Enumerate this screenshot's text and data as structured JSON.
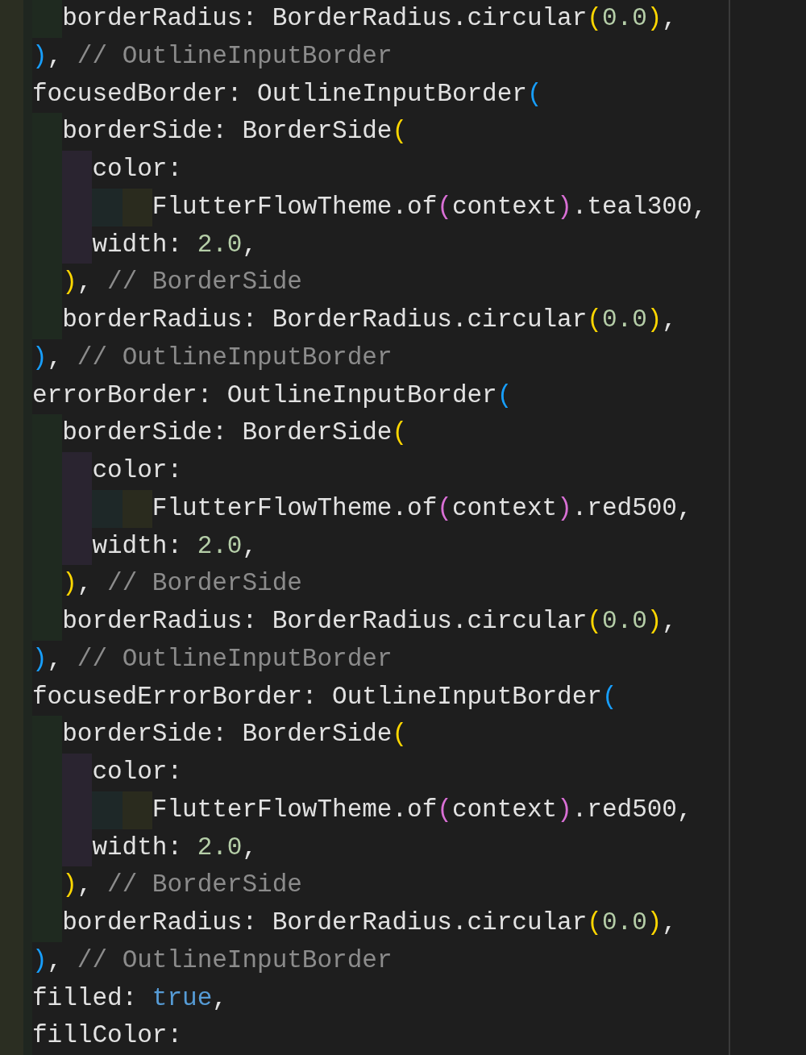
{
  "editor": {
    "lines": [
      {
        "tokens": [
          {
            "text": "  borderRadius: BorderRadius.circular",
            "color": "#e2e2e2"
          },
          {
            "text": "(",
            "color": "#ffd700"
          },
          {
            "text": "0.0",
            "color": "#b5cea8"
          },
          {
            "text": ")",
            "color": "#ffd700"
          },
          {
            "text": ",",
            "color": "#e2e2e2"
          }
        ]
      },
      {
        "tokens": [
          {
            "text": ")",
            "color": "#179fff"
          },
          {
            "text": ", ",
            "color": "#e2e2e2"
          },
          {
            "text": "// OutlineInputBorder",
            "color": "#8c8c8c"
          }
        ]
      },
      {
        "tokens": [
          {
            "text": "focusedBorder: OutlineInputBorder",
            "color": "#e2e2e2"
          },
          {
            "text": "(",
            "color": "#179fff"
          }
        ]
      },
      {
        "tokens": [
          {
            "text": "  borderSide: BorderSide",
            "color": "#e2e2e2"
          },
          {
            "text": "(",
            "color": "#ffd700"
          }
        ]
      },
      {
        "tokens": [
          {
            "text": "    color:",
            "color": "#e2e2e2"
          }
        ]
      },
      {
        "tokens": [
          {
            "text": "        FlutterFlowTheme.of",
            "color": "#e2e2e2"
          },
          {
            "text": "(",
            "color": "#da70d6"
          },
          {
            "text": "context",
            "color": "#e2e2e2"
          },
          {
            "text": ")",
            "color": "#da70d6"
          },
          {
            "text": ".teal300,",
            "color": "#e2e2e2"
          }
        ]
      },
      {
        "tokens": [
          {
            "text": "    width: ",
            "color": "#e2e2e2"
          },
          {
            "text": "2.0",
            "color": "#b5cea8"
          },
          {
            "text": ",",
            "color": "#e2e2e2"
          }
        ]
      },
      {
        "tokens": [
          {
            "text": "  )",
            "color": "#ffd700"
          },
          {
            "text": ", ",
            "color": "#e2e2e2"
          },
          {
            "text": "// BorderSide",
            "color": "#8c8c8c"
          }
        ]
      },
      {
        "tokens": [
          {
            "text": "  borderRadius: BorderRadius.circular",
            "color": "#e2e2e2"
          },
          {
            "text": "(",
            "color": "#ffd700"
          },
          {
            "text": "0.0",
            "color": "#b5cea8"
          },
          {
            "text": ")",
            "color": "#ffd700"
          },
          {
            "text": ",",
            "color": "#e2e2e2"
          }
        ]
      },
      {
        "tokens": [
          {
            "text": ")",
            "color": "#179fff"
          },
          {
            "text": ", ",
            "color": "#e2e2e2"
          },
          {
            "text": "// OutlineInputBorder",
            "color": "#8c8c8c"
          }
        ]
      },
      {
        "tokens": [
          {
            "text": "errorBorder: OutlineInputBorder",
            "color": "#e2e2e2"
          },
          {
            "text": "(",
            "color": "#179fff"
          }
        ]
      },
      {
        "tokens": [
          {
            "text": "  borderSide: BorderSide",
            "color": "#e2e2e2"
          },
          {
            "text": "(",
            "color": "#ffd700"
          }
        ]
      },
      {
        "tokens": [
          {
            "text": "    color:",
            "color": "#e2e2e2"
          }
        ]
      },
      {
        "tokens": [
          {
            "text": "        FlutterFlowTheme.of",
            "color": "#e2e2e2"
          },
          {
            "text": "(",
            "color": "#da70d6"
          },
          {
            "text": "context",
            "color": "#e2e2e2"
          },
          {
            "text": ")",
            "color": "#da70d6"
          },
          {
            "text": ".red500,",
            "color": "#e2e2e2"
          }
        ]
      },
      {
        "tokens": [
          {
            "text": "    width: ",
            "color": "#e2e2e2"
          },
          {
            "text": "2.0",
            "color": "#b5cea8"
          },
          {
            "text": ",",
            "color": "#e2e2e2"
          }
        ]
      },
      {
        "tokens": [
          {
            "text": "  )",
            "color": "#ffd700"
          },
          {
            "text": ", ",
            "color": "#e2e2e2"
          },
          {
            "text": "// BorderSide",
            "color": "#8c8c8c"
          }
        ]
      },
      {
        "tokens": [
          {
            "text": "  borderRadius: BorderRadius.circular",
            "color": "#e2e2e2"
          },
          {
            "text": "(",
            "color": "#ffd700"
          },
          {
            "text": "0.0",
            "color": "#b5cea8"
          },
          {
            "text": ")",
            "color": "#ffd700"
          },
          {
            "text": ",",
            "color": "#e2e2e2"
          }
        ]
      },
      {
        "tokens": [
          {
            "text": ")",
            "color": "#179fff"
          },
          {
            "text": ", ",
            "color": "#e2e2e2"
          },
          {
            "text": "// OutlineInputBorder",
            "color": "#8c8c8c"
          }
        ]
      },
      {
        "tokens": [
          {
            "text": "focusedErrorBorder: OutlineInputBorder",
            "color": "#e2e2e2"
          },
          {
            "text": "(",
            "color": "#179fff"
          }
        ]
      },
      {
        "tokens": [
          {
            "text": "  borderSide: BorderSide",
            "color": "#e2e2e2"
          },
          {
            "text": "(",
            "color": "#ffd700"
          }
        ]
      },
      {
        "tokens": [
          {
            "text": "    color:",
            "color": "#e2e2e2"
          }
        ]
      },
      {
        "tokens": [
          {
            "text": "        FlutterFlowTheme.of",
            "color": "#e2e2e2"
          },
          {
            "text": "(",
            "color": "#da70d6"
          },
          {
            "text": "context",
            "color": "#e2e2e2"
          },
          {
            "text": ")",
            "color": "#da70d6"
          },
          {
            "text": ".red500,",
            "color": "#e2e2e2"
          }
        ]
      },
      {
        "tokens": [
          {
            "text": "    width: ",
            "color": "#e2e2e2"
          },
          {
            "text": "2.0",
            "color": "#b5cea8"
          },
          {
            "text": ",",
            "color": "#e2e2e2"
          }
        ]
      },
      {
        "tokens": [
          {
            "text": "  )",
            "color": "#ffd700"
          },
          {
            "text": ", ",
            "color": "#e2e2e2"
          },
          {
            "text": "// BorderSide",
            "color": "#8c8c8c"
          }
        ]
      },
      {
        "tokens": [
          {
            "text": "  borderRadius: BorderRadius.circular",
            "color": "#e2e2e2"
          },
          {
            "text": "(",
            "color": "#ffd700"
          },
          {
            "text": "0.0",
            "color": "#b5cea8"
          },
          {
            "text": ")",
            "color": "#ffd700"
          },
          {
            "text": ",",
            "color": "#e2e2e2"
          }
        ]
      },
      {
        "tokens": [
          {
            "text": ")",
            "color": "#179fff"
          },
          {
            "text": ", ",
            "color": "#e2e2e2"
          },
          {
            "text": "// OutlineInputBorder",
            "color": "#8c8c8c"
          }
        ]
      },
      {
        "tokens": [
          {
            "text": "filled: ",
            "color": "#e2e2e2"
          },
          {
            "text": "true",
            "color": "#569cd6"
          },
          {
            "text": ",",
            "color": "#e2e2e2"
          }
        ]
      },
      {
        "tokens": [
          {
            "text": "fillColor:",
            "color": "#e2e2e2"
          }
        ]
      }
    ]
  }
}
